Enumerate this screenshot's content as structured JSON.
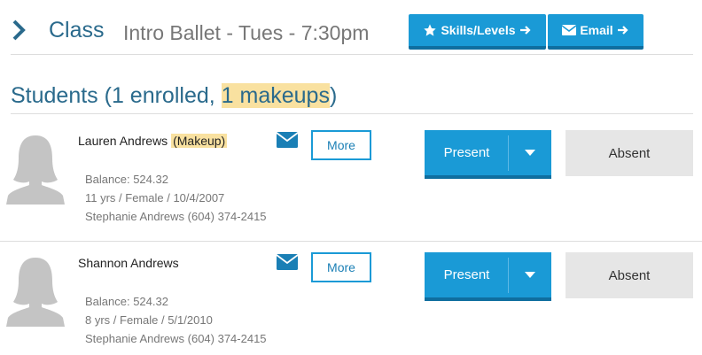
{
  "header": {
    "section_label": "Class",
    "class_name": "Intro Ballet - Tues - 7:30pm",
    "skills_button": "Skills/Levels",
    "email_button": "Email"
  },
  "students_heading": {
    "prefix": "Students (1 enrolled, ",
    "makeups": "1 makeups",
    "suffix": ")"
  },
  "students": [
    {
      "name": "Lauren Andrews",
      "tag": "(Makeup)",
      "balance": "Balance: 524.32",
      "details": "11 yrs / Female / 10/4/2007",
      "contact": "Stephanie Andrews (604) 374-2415",
      "more_label": "More",
      "present_label": "Present",
      "absent_label": "Absent"
    },
    {
      "name": "Shannon Andrews",
      "tag": "",
      "balance": "Balance: 524.32",
      "details": "8 yrs / Female / 5/1/2010",
      "contact": "Stephanie Andrews (604) 374-2415",
      "more_label": "More",
      "present_label": "Present",
      "absent_label": "Absent"
    }
  ],
  "colors": {
    "accent": "#1a9ad6",
    "accent_dark": "#0f6e9f",
    "title": "#2a6a8c",
    "highlight": "#f9e1a0",
    "absent_bg": "#e6e6e6"
  },
  "icons": {
    "nav": "chevron-right-icon",
    "skills": "star-icon",
    "email": "envelope-icon",
    "arrow": "arrow-right-icon",
    "caret": "caret-down-icon",
    "avatar": "person-silhouette-icon"
  }
}
